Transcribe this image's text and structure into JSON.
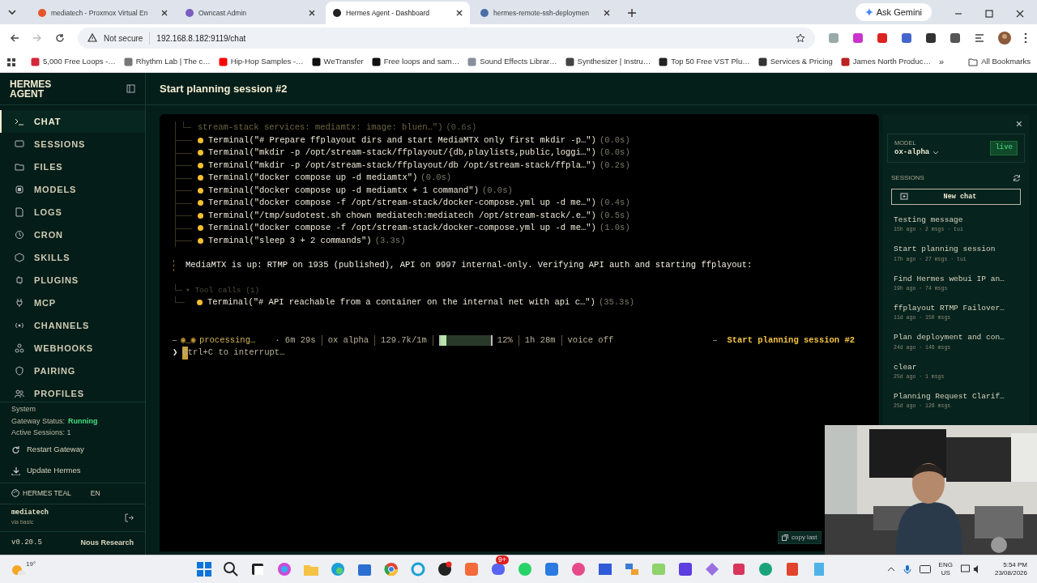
{
  "browser": {
    "tabs": [
      {
        "title": "mediatech - Proxmox Virtual En",
        "selected": false
      },
      {
        "title": "Owncast Admin",
        "selected": false
      },
      {
        "title": "Hermes Agent - Dashboard",
        "selected": true
      },
      {
        "title": "hermes-remote-ssh-deploymen",
        "selected": false
      }
    ],
    "ask_gemini": "Ask Gemini",
    "not_secure": "Not secure",
    "url": "192.168.8.182:9119/chat",
    "bookmarks": [
      "5,000 Free Loops -…",
      "Rhythm Lab | The c…",
      "Hip-Hop Samples -…",
      "WeTransfer",
      "Free loops and sam…",
      "Sound Effects Librar…",
      "Synthesizer | Instru…",
      "Top 50 Free VST Plu…",
      "Services & Pricing",
      "James North Produc…"
    ],
    "more_bookmarks": "»",
    "all_bookmarks": "All Bookmarks"
  },
  "sidebar": {
    "brand": "HERMES AGENT",
    "nav": [
      {
        "label": "CHAT",
        "selected": true
      },
      {
        "label": "SESSIONS",
        "selected": false
      },
      {
        "label": "FILES",
        "selected": false
      },
      {
        "label": "MODELS",
        "selected": false
      },
      {
        "label": "LOGS",
        "selected": false
      },
      {
        "label": "CRON",
        "selected": false
      },
      {
        "label": "SKILLS",
        "selected": false
      },
      {
        "label": "PLUGINS",
        "selected": false
      },
      {
        "label": "MCP",
        "selected": false
      },
      {
        "label": "CHANNELS",
        "selected": false
      },
      {
        "label": "WEBHOOKS",
        "selected": false
      },
      {
        "label": "PAIRING",
        "selected": false
      },
      {
        "label": "PROFILES",
        "selected": false
      }
    ],
    "system_label": "System",
    "gateway_label": "Gateway Status:",
    "gateway_status": "Running",
    "active_sessions": "Active Sessions: 1",
    "actions": [
      "Restart Gateway",
      "Update Hermes"
    ],
    "theme": "HERMES TEAL",
    "language": "EN",
    "user": "mediatech",
    "user_via": "via basic",
    "version": "v0.20.5",
    "vendor": "Nous Research"
  },
  "main": {
    "title": "Start planning session #2",
    "terminal": {
      "lines": [
        {
          "kind": "note",
          "text": "stream-stack services: mediamtx: image: bluen…\")",
          "time": "(0.6s)"
        },
        {
          "kind": "tool",
          "text": "Terminal(\"# Prepare ffplayout dirs and start MediaMTX only first mkdir -p…\")",
          "time": "(0.0s)"
        },
        {
          "kind": "tool",
          "text": "Terminal(\"mkdir -p /opt/stream-stack/ffplayout/{db,playlists,public,loggi…\")",
          "time": "(0.0s)"
        },
        {
          "kind": "tool",
          "text": "Terminal(\"mkdir -p /opt/stream-stack/ffplayout/db /opt/stream-stack/ffpla…\")",
          "time": "(0.2s)"
        },
        {
          "kind": "tool",
          "text": "Terminal(\"docker compose up -d mediamtx\")",
          "time": "(0.0s)"
        },
        {
          "kind": "tool",
          "text": "Terminal(\"docker compose up -d mediamtx + 1 command\")",
          "time": "(0.0s)"
        },
        {
          "kind": "tool",
          "text": "Terminal(\"docker compose -f /opt/stream-stack/docker-compose.yml up -d me…\")",
          "time": "(0.4s)"
        },
        {
          "kind": "tool",
          "text": "Terminal(\"/tmp/sudotest.sh chown mediatech:mediatech /opt/stream-stack/.e…\")",
          "time": "(0.5s)"
        },
        {
          "kind": "tool",
          "text": "Terminal(\"docker compose -f /opt/stream-stack/docker-compose.yml up -d me…\")",
          "time": "(1.0s)"
        },
        {
          "kind": "tool",
          "text": "Terminal(\"sleep 3 + 2 commands\")",
          "time": "(3.3s)"
        }
      ],
      "message": "MediaMTX is up: RTMP on 1935 (published), API on 9997 internal-only. Verifying API auth and starting ffplayout:",
      "tool_calls": {
        "label": "▾ Tool calls (1)",
        "items": [
          {
            "text": "Terminal(\"# API reachable from a container on the internal net with api c…\")",
            "time": "(35.3s)"
          }
        ]
      },
      "status": {
        "spinner": "◉_◉",
        "state": "processing…",
        "elapsed": "· 6m 29s",
        "model": "ox alpha",
        "tokens": "129.7k/1m",
        "level": 0.12,
        "percent": "12%",
        "remaining": "1h 28m",
        "voice": "voice off",
        "session": "Start planning session #2"
      },
      "prompt": {
        "symbol": "❯",
        "hint": "Ctrl+C to interrupt…"
      }
    },
    "copy_button": "copy last"
  },
  "panel": {
    "close": "×",
    "model_label": "MODEL",
    "model": "ox-alpha",
    "live": "live",
    "sessions_label": "SESSIONS",
    "new_chat": "New chat",
    "sessions": [
      {
        "title": "Testing message",
        "meta": "15h ago · 2 msgs · tui"
      },
      {
        "title": "Start planning session",
        "meta": "17h ago · 27 msgs · tui"
      },
      {
        "title": "Find Hermes webui IP an…",
        "meta": "19h ago · 74 msgs"
      },
      {
        "title": "ffplayout RTMP Failover…",
        "meta": "11d ago · 150 msgs"
      },
      {
        "title": "Plan deployment and con…",
        "meta": "24d ago · 146 msgs"
      },
      {
        "title": "clear",
        "meta": "25d ago · 1 msgs"
      },
      {
        "title": "Planning Request Clarif…",
        "meta": "25d ago · 126 msgs"
      }
    ]
  },
  "taskbar": {
    "weather": "19°",
    "badge": "9+",
    "lang": "ENG",
    "region": "US",
    "time": "5:54 PM",
    "date": "23/08/2026"
  }
}
